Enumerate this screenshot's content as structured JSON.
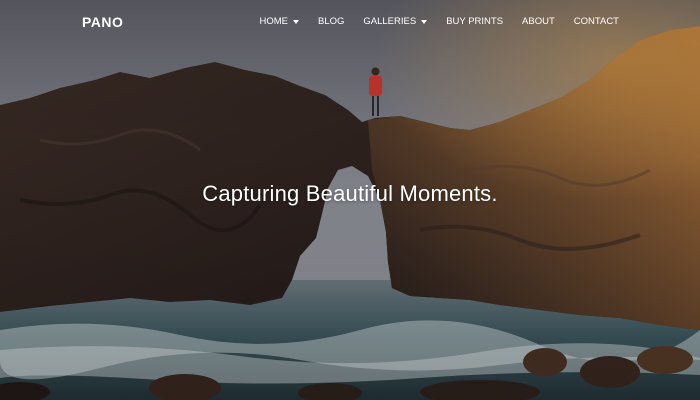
{
  "brand": {
    "name": "PANO"
  },
  "nav": {
    "items": [
      {
        "label": "HOME",
        "has_dropdown": true
      },
      {
        "label": "BLOG",
        "has_dropdown": false
      },
      {
        "label": "GALLERIES",
        "has_dropdown": true
      },
      {
        "label": "BUY PRINTS",
        "has_dropdown": false
      },
      {
        "label": "ABOUT",
        "has_dropdown": false
      },
      {
        "label": "CONTACT",
        "has_dropdown": false
      }
    ]
  },
  "hero": {
    "headline": "Capturing Beautiful Moments."
  },
  "colors": {
    "text": "#ffffff",
    "sky": "#8c8f98",
    "rock_light": "#b07838",
    "rock_dark": "#2a1f1c",
    "sea": "#3e5a62",
    "jacket": "#c8372f"
  }
}
